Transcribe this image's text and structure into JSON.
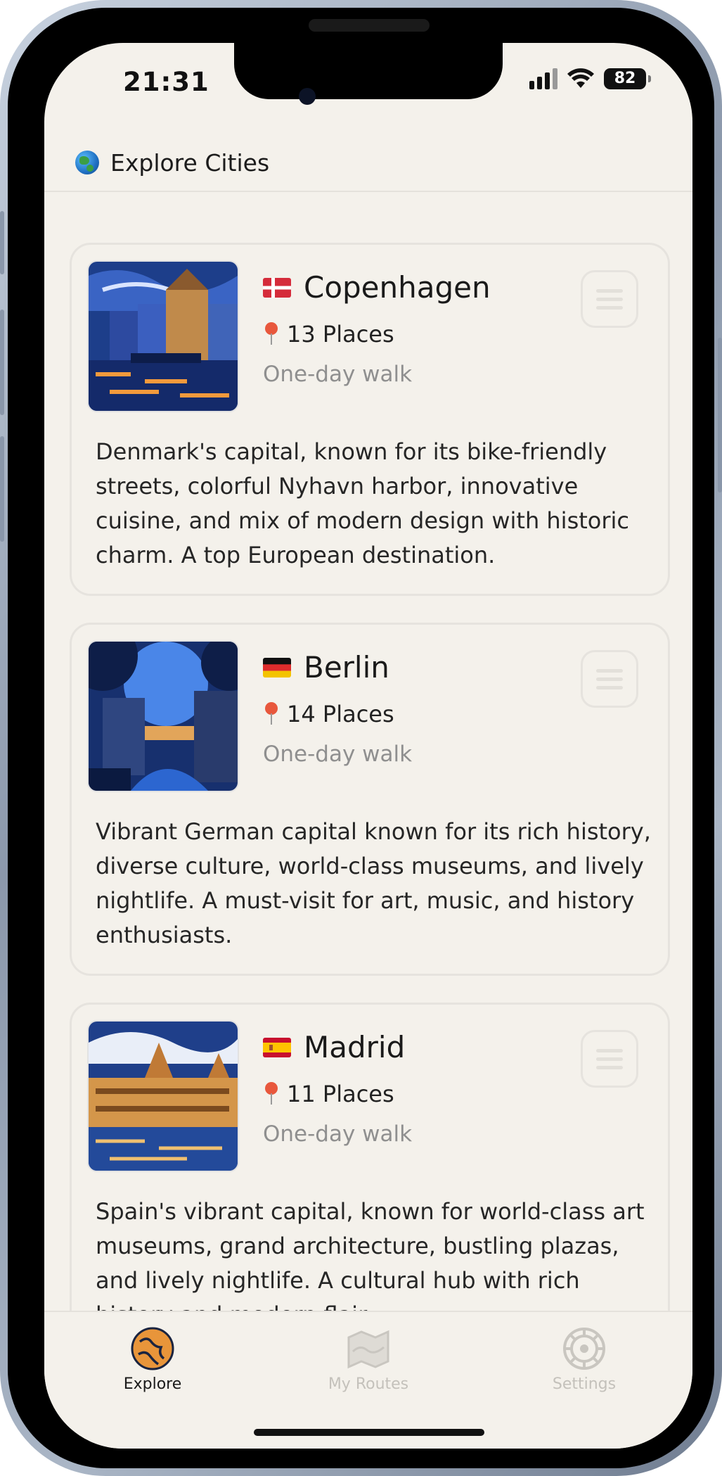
{
  "status_bar": {
    "time": "21:31",
    "battery": "82"
  },
  "header": {
    "icon": "globe-icon",
    "title": "Explore Cities"
  },
  "cities": [
    {
      "name": "Copenhagen",
      "flag": "denmark-flag",
      "places": "13 Places",
      "walk": "One-day walk",
      "description": "Denmark's capital, known for its bike-friendly streets, colorful Nyhavn harbor, innovative cuisine, and mix of modern design with historic charm. A top European destination."
    },
    {
      "name": "Berlin",
      "flag": "germany-flag",
      "places": "14 Places",
      "walk": "One-day walk",
      "description": "Vibrant German capital known for its rich history, diverse culture, world-class museums, and lively nightlife. A must-visit for art, music, and history enthusiasts."
    },
    {
      "name": "Madrid",
      "flag": "spain-flag",
      "places": "11 Places",
      "walk": "One-day walk",
      "description": "Spain's vibrant capital, known for world-class art museums, grand architecture, bustling plazas, and lively nightlife. A cultural hub with rich history and modern flair."
    }
  ],
  "tabbar": {
    "tabs": [
      {
        "label": "Explore",
        "icon": "globe-map-icon",
        "active": true
      },
      {
        "label": "My Routes",
        "icon": "map-icon",
        "active": false
      },
      {
        "label": "Settings",
        "icon": "gear-icon",
        "active": false
      }
    ]
  },
  "colors": {
    "background": "#f4f1eb",
    "accent": "#e8953a",
    "inactive": "#c9c6c0",
    "text": "#1a1a1a",
    "muted": "#8f8f8f"
  }
}
